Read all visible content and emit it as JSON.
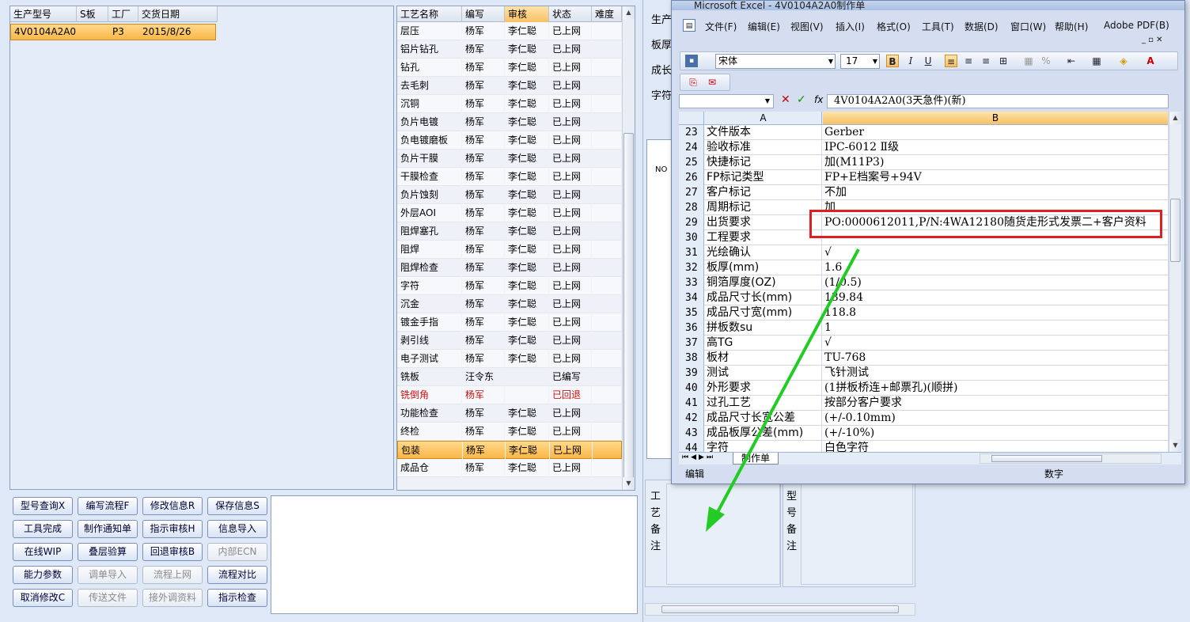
{
  "left_table": {
    "headers": [
      "生产型号",
      "S板",
      "工厂",
      "交货日期"
    ],
    "rows": [
      {
        "model": "4V0104A2A0",
        "s": "",
        "factory": "P3",
        "date": "2015/8/26"
      }
    ]
  },
  "process_table": {
    "headers": [
      "工艺名称",
      "编写",
      "审核",
      "状态",
      "难度"
    ],
    "rows": [
      {
        "name": "层压",
        "writer": "杨军",
        "reviewer": "李仁聪",
        "status": "已上网"
      },
      {
        "name": "铝片钻孔",
        "writer": "杨军",
        "reviewer": "李仁聪",
        "status": "已上网"
      },
      {
        "name": "钻孔",
        "writer": "杨军",
        "reviewer": "李仁聪",
        "status": "已上网"
      },
      {
        "name": "去毛刺",
        "writer": "杨军",
        "reviewer": "李仁聪",
        "status": "已上网"
      },
      {
        "name": "沉铜",
        "writer": "杨军",
        "reviewer": "李仁聪",
        "status": "已上网"
      },
      {
        "name": "负片电镀",
        "writer": "杨军",
        "reviewer": "李仁聪",
        "status": "已上网"
      },
      {
        "name": "负电镀磨板",
        "writer": "杨军",
        "reviewer": "李仁聪",
        "status": "已上网"
      },
      {
        "name": "负片干膜",
        "writer": "杨军",
        "reviewer": "李仁聪",
        "status": "已上网"
      },
      {
        "name": "干膜检查",
        "writer": "杨军",
        "reviewer": "李仁聪",
        "status": "已上网"
      },
      {
        "name": "负片蚀刻",
        "writer": "杨军",
        "reviewer": "李仁聪",
        "status": "已上网"
      },
      {
        "name": "外层AOI",
        "writer": "杨军",
        "reviewer": "李仁聪",
        "status": "已上网"
      },
      {
        "name": "阻焊塞孔",
        "writer": "杨军",
        "reviewer": "李仁聪",
        "status": "已上网"
      },
      {
        "name": "阻焊",
        "writer": "杨军",
        "reviewer": "李仁聪",
        "status": "已上网"
      },
      {
        "name": "阻焊检查",
        "writer": "杨军",
        "reviewer": "李仁聪",
        "status": "已上网"
      },
      {
        "name": "字符",
        "writer": "杨军",
        "reviewer": "李仁聪",
        "status": "已上网"
      },
      {
        "name": "沉金",
        "writer": "杨军",
        "reviewer": "李仁聪",
        "status": "已上网"
      },
      {
        "name": "镀金手指",
        "writer": "杨军",
        "reviewer": "李仁聪",
        "status": "已上网"
      },
      {
        "name": "剥引线",
        "writer": "杨军",
        "reviewer": "李仁聪",
        "status": "已上网"
      },
      {
        "name": "电子测试",
        "writer": "杨军",
        "reviewer": "李仁聪",
        "status": "已上网"
      },
      {
        "name": "铣板",
        "writer": "汪令东",
        "reviewer": "",
        "status": "已编写"
      },
      {
        "name": "铣倒角",
        "writer": "杨军",
        "reviewer": "",
        "status": "已回退",
        "highlight": "red"
      },
      {
        "name": "功能检查",
        "writer": "杨军",
        "reviewer": "李仁聪",
        "status": "已上网"
      },
      {
        "name": "终检",
        "writer": "杨军",
        "reviewer": "李仁聪",
        "status": "已上网"
      },
      {
        "name": "包装",
        "writer": "杨军",
        "reviewer": "李仁聪",
        "status": "已上网",
        "selected": true
      },
      {
        "name": "成品仓",
        "writer": "杨军",
        "reviewer": "李仁聪",
        "status": "已上网"
      }
    ]
  },
  "buttons": [
    {
      "label": "型号查询X",
      "enabled": true
    },
    {
      "label": "编写流程F",
      "enabled": true
    },
    {
      "label": "修改信息R",
      "enabled": true
    },
    {
      "label": "保存信息S",
      "enabled": true
    },
    {
      "label": "工具完成",
      "enabled": true
    },
    {
      "label": "制作通知单",
      "enabled": true
    },
    {
      "label": "指示审核H",
      "enabled": true
    },
    {
      "label": "信息导入",
      "enabled": true
    },
    {
      "label": "在线WIP",
      "enabled": true
    },
    {
      "label": "叠层验算",
      "enabled": true
    },
    {
      "label": "回退审核B",
      "enabled": true
    },
    {
      "label": "内部ECN",
      "enabled": false
    },
    {
      "label": "能力参数",
      "enabled": true
    },
    {
      "label": "调单导入",
      "enabled": false
    },
    {
      "label": "流程上网",
      "enabled": false
    },
    {
      "label": "流程对比",
      "enabled": true
    },
    {
      "label": "取消修改C",
      "enabled": true
    },
    {
      "label": "传送文件",
      "enabled": false
    },
    {
      "label": "接外调资料",
      "enabled": false
    },
    {
      "label": "指示检查",
      "enabled": true
    }
  ],
  "right_panel": {
    "labels": [
      "生产",
      "板厚",
      "成长",
      "字符"
    ],
    "no_label": "NO",
    "process_note": "工艺备注",
    "model_note": "型号备注"
  },
  "excel": {
    "title": "Microsoft Excel - 4V0104A2A0制作单",
    "menu": [
      "文件(F)",
      "编辑(E)",
      "视图(V)",
      "插入(I)",
      "格式(O)",
      "工具(T)",
      "数据(D)",
      "窗口(W)",
      "帮助(H)",
      "Adobe PDF(B)"
    ],
    "font_name": "宋体",
    "font_size": "17",
    "formula": "4V0104A2A0(3天急件)(新)",
    "col_a": "A",
    "col_b": "B",
    "rows": [
      {
        "n": "23",
        "a": "文件版本",
        "b": "Gerber"
      },
      {
        "n": "24",
        "a": "验收标准",
        "b": "IPC-6012 Ⅱ级"
      },
      {
        "n": "25",
        "a": "快捷标记",
        "b": "加(M11P3)"
      },
      {
        "n": "26",
        "a": "FP标记类型",
        "b": "FP+E档案号+94V"
      },
      {
        "n": "27",
        "a": "客户标记",
        "b": "不加"
      },
      {
        "n": "28",
        "a": "周期标记",
        "b": "加"
      },
      {
        "n": "29",
        "a": "出货要求",
        "b": "PO:0000612011,P/N:4WA12180随货走形式发票二+客户资料"
      },
      {
        "n": "30",
        "a": "工程要求",
        "b": ""
      },
      {
        "n": "31",
        "a": "光绘确认",
        "b": "√"
      },
      {
        "n": "32",
        "a": "板厚(mm)",
        "b": "1.6"
      },
      {
        "n": "33",
        "a": "铜箔厚度(OZ)",
        "b": "(1/0.5)"
      },
      {
        "n": "34",
        "a": "成品尺寸长(mm)",
        "b": "139.84"
      },
      {
        "n": "35",
        "a": "成品尺寸宽(mm)",
        "b": "118.8"
      },
      {
        "n": "36",
        "a": "拼板数su",
        "b": "1"
      },
      {
        "n": "37",
        "a": "高TG",
        "b": "√"
      },
      {
        "n": "38",
        "a": "板材",
        "b": "TU-768"
      },
      {
        "n": "39",
        "a": "测试",
        "b": "飞针测试"
      },
      {
        "n": "40",
        "a": "外形要求",
        "b": "(1拼板桥连+邮票孔)(顺拼)"
      },
      {
        "n": "41",
        "a": "过孔工艺",
        "b": "按部分客户要求"
      },
      {
        "n": "42",
        "a": "成品尺寸长宽公差",
        "b": "(+/-0.10mm)"
      },
      {
        "n": "43",
        "a": "成品板厚公差(mm)",
        "b": "(+/-10%)"
      },
      {
        "n": "44",
        "a": "字符",
        "b": "白色字符"
      }
    ],
    "sheet_tab": "制作单",
    "status_left": "编辑",
    "status_right": "数字",
    "highlight_color": "#e02020",
    "arrow_color": "#22cc22"
  }
}
